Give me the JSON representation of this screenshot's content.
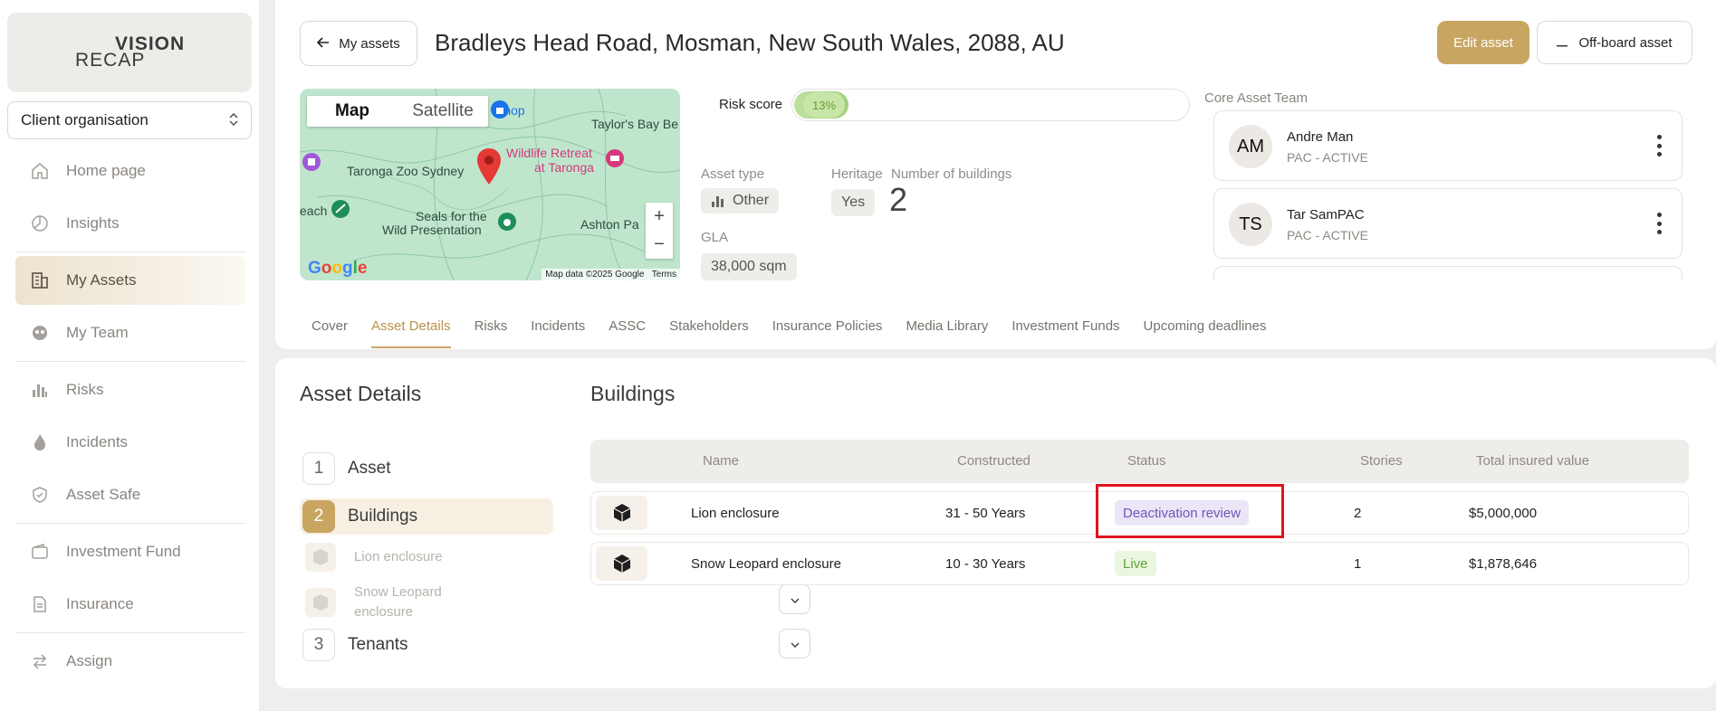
{
  "brand": {
    "logo_line1": "VISION",
    "logo_line2": "RECAP",
    "accent": "#c8a662"
  },
  "sidebar": {
    "org_select": "Client organisation",
    "items": [
      {
        "label": "Home page",
        "icon": "home-icon"
      },
      {
        "label": "Insights",
        "icon": "pie-chart-icon"
      },
      {
        "label": "My Assets",
        "icon": "building-icon",
        "active": true
      },
      {
        "label": "My Team",
        "icon": "team-icon"
      },
      {
        "label": "Risks",
        "icon": "bar-chart-icon"
      },
      {
        "label": "Incidents",
        "icon": "flame-icon"
      },
      {
        "label": "Asset Safe",
        "icon": "shield-icon"
      },
      {
        "label": "Investment Fund",
        "icon": "wallet-icon"
      },
      {
        "label": "Insurance",
        "icon": "document-icon"
      },
      {
        "label": "Assign",
        "icon": "arrows-icon"
      }
    ]
  },
  "header": {
    "back_label": "My assets",
    "title": "Bradleys Head Road, Mosman, New South Wales, 2088, AU",
    "edit_label": "Edit asset",
    "offboard_label": "Off-board asset"
  },
  "map": {
    "tab_map": "Map",
    "tab_satellite": "Satellite",
    "labels": {
      "shop": "Shop",
      "taylors_bay": "Taylor's Bay Be",
      "wildlife": "Wildlife Retreat",
      "taronga": "at Taronga",
      "zoo": "Taronga Zoo Sydney",
      "beach": "each",
      "seals1": "Seals for the",
      "seals2": "Wild Presentation",
      "ashton": "Ashton Pa"
    },
    "google": "Google",
    "attribution": "Map data ©2025 Google",
    "terms": "Terms",
    "zoom_in": "+",
    "zoom_out": "−"
  },
  "risk": {
    "label": "Risk score",
    "value_text": "13%",
    "value": 0.13
  },
  "asset": {
    "type_label": "Asset type",
    "type_value": "Other",
    "heritage_label": "Heritage",
    "heritage_value": "Yes",
    "buildings_label": "Number of buildings",
    "buildings_value": "2",
    "gla_label": "GLA",
    "gla_value": "38,000 sqm"
  },
  "team": {
    "label": "Core Asset Team",
    "members": [
      {
        "initials": "AM",
        "name": "Andre Man",
        "role": "PAC - ACTIVE"
      },
      {
        "initials": "TS",
        "name": "Tar SamPAC",
        "role": "PAC - ACTIVE"
      }
    ]
  },
  "tabs": [
    "Cover",
    "Asset Details",
    "Risks",
    "Incidents",
    "ASSC",
    "Stakeholders",
    "Insurance Policies",
    "Media Library",
    "Investment Funds",
    "Upcoming deadlines"
  ],
  "details": {
    "title": "Asset Details",
    "steps": [
      {
        "num": "1",
        "label": "Asset"
      },
      {
        "num": "2",
        "label": "Buildings"
      },
      {
        "num": "3",
        "label": "Tenants"
      }
    ],
    "sub_items": [
      "Lion enclosure",
      "Snow Leopard enclosure"
    ]
  },
  "buildings": {
    "title": "Buildings",
    "columns": [
      "Name",
      "Constructed",
      "Status",
      "Stories",
      "Total insured value"
    ],
    "rows": [
      {
        "name": "Lion enclosure",
        "constructed": "31 - 50 Years",
        "status": "Deactivation review",
        "stories": "2",
        "value": "$5,000,000"
      },
      {
        "name": "Snow Leopard enclosure",
        "constructed": "10 - 30 Years",
        "status": "Live",
        "stories": "1",
        "value": "$1,878,646"
      }
    ]
  }
}
